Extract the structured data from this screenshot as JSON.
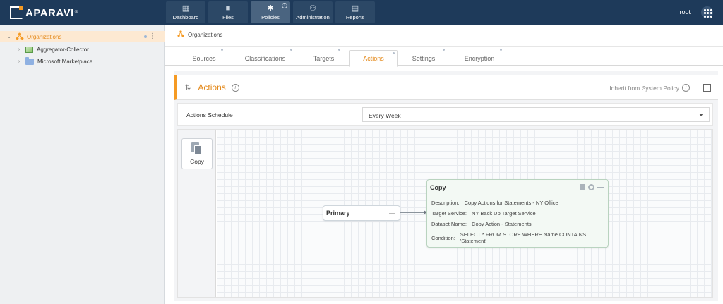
{
  "app": {
    "logo": "APARAVI",
    "trademark": "®"
  },
  "nav": [
    {
      "label": "Dashboard",
      "icon": "grid-icon"
    },
    {
      "label": "Files",
      "icon": "folder-icon"
    },
    {
      "label": "Policies",
      "icon": "gear-icon",
      "active": true
    },
    {
      "label": "Administration",
      "icon": "users-icon"
    },
    {
      "label": "Reports",
      "icon": "clipboard-icon"
    }
  ],
  "user": "root",
  "sidebar": {
    "items": [
      {
        "label": "Organizations",
        "selected": true
      },
      {
        "label": "Aggregator-Collector"
      },
      {
        "label": "Microsoft Marketplace"
      }
    ]
  },
  "breadcrumb": "Organizations",
  "tabs": [
    "Sources",
    "Classifications",
    "Targets",
    "Actions",
    "Settings",
    "Encryption"
  ],
  "active_tab": "Actions",
  "actions": {
    "title": "Actions",
    "info_symbol": "i",
    "inherit_label": "Inherit from System Policy",
    "schedule_label": "Actions Schedule",
    "schedule_value": "Every Week"
  },
  "palette": {
    "copy_label": "Copy"
  },
  "flow": {
    "primary_label": "Primary",
    "copy_node": {
      "title": "Copy",
      "fields": [
        {
          "key": "Description:",
          "value": "Copy Actions for Statements - NY Office"
        },
        {
          "key": "Target Service:",
          "value": "NY Back Up Target Service"
        },
        {
          "key": "Dataset Name:",
          "value": "Copy Action - Statements"
        },
        {
          "key": "Condition:",
          "value": "SELECT * FROM STORE WHERE Name CONTAINS 'Statement'"
        }
      ]
    }
  },
  "colors": {
    "topbar": "#1e3a5a",
    "accent": "#f59a23",
    "selected_row": "#fde9d2"
  }
}
